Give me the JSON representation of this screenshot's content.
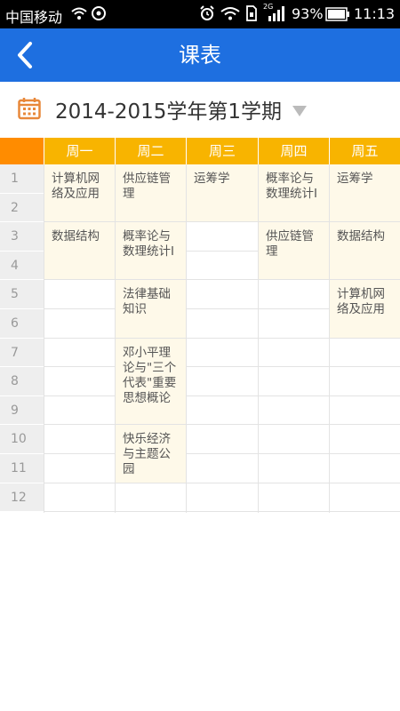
{
  "status_bar": {
    "carrier": "中国移动",
    "network": "2G",
    "battery": "93%",
    "time": "11:13",
    "icons": [
      "wifi-icon",
      "sync-icon",
      "alarm-icon",
      "wifi-icon",
      "sim-icon",
      "signal-icon",
      "battery-icon"
    ]
  },
  "app_bar": {
    "title": "课表",
    "back_icon": "chevron-left-icon"
  },
  "semester": {
    "label": "2014-2015学年第1学期",
    "icon": "calendar-icon",
    "dropdown_icon": "triangle-down-icon"
  },
  "colors": {
    "app_bar": "#1e6fe0",
    "header": "#f8b400",
    "header_corner": "#ff8c00",
    "course_bg": "#fef9e9",
    "calendar_icon": "#e8883a"
  },
  "timetable": {
    "days": [
      "周一",
      "周二",
      "周三",
      "周四",
      "周五"
    ],
    "periods": [
      "1",
      "2",
      "3",
      "4",
      "5",
      "6",
      "7",
      "8",
      "9",
      "10",
      "11",
      "12"
    ],
    "courses": [
      {
        "day": 1,
        "start": 1,
        "span": 2,
        "name": "计算机网络及应用"
      },
      {
        "day": 1,
        "start": 3,
        "span": 2,
        "name": "数据结构"
      },
      {
        "day": 2,
        "start": 1,
        "span": 2,
        "name": "供应链管理"
      },
      {
        "day": 2,
        "start": 3,
        "span": 2,
        "name": "概率论与数理统计I"
      },
      {
        "day": 2,
        "start": 5,
        "span": 2,
        "name": "法律基础知识"
      },
      {
        "day": 2,
        "start": 7,
        "span": 3,
        "name": "邓小平理论与\"三个代表\"重要思想概论"
      },
      {
        "day": 2,
        "start": 10,
        "span": 2,
        "name": "快乐经济与主题公园"
      },
      {
        "day": 3,
        "start": 1,
        "span": 2,
        "name": "运筹学"
      },
      {
        "day": 4,
        "start": 1,
        "span": 2,
        "name": "概率论与数理统计I"
      },
      {
        "day": 4,
        "start": 3,
        "span": 2,
        "name": "供应链管理"
      },
      {
        "day": 5,
        "start": 1,
        "span": 2,
        "name": "运筹学"
      },
      {
        "day": 5,
        "start": 3,
        "span": 2,
        "name": "数据结构"
      },
      {
        "day": 5,
        "start": 5,
        "span": 2,
        "name": "计算机网络及应用"
      }
    ]
  }
}
